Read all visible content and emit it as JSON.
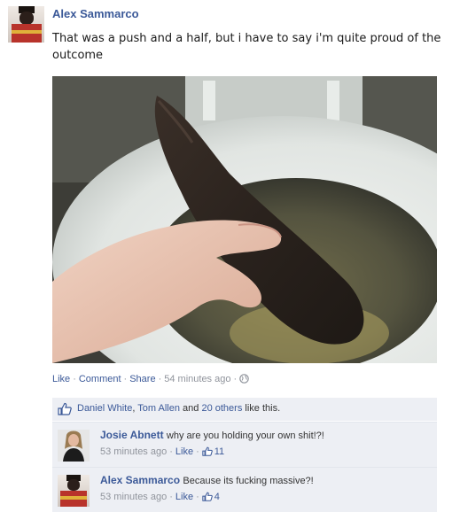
{
  "post": {
    "author": "Alex Sammarco",
    "status_text": "That was a push and a half, but i have to say i'm quite proud of the outcome"
  },
  "actions": {
    "like": "Like",
    "comment": "Comment",
    "share": "Share",
    "separator": "·",
    "timestamp": "54 minutes ago",
    "privacy_icon": "globe-icon"
  },
  "likes": {
    "name_1": "Daniel White",
    "comma": ",",
    "name_2": "Tom Allen",
    "and": "and",
    "others": "20 others",
    "suffix": "like this.",
    "icon": "thumbs-up-icon"
  },
  "comments": [
    {
      "author": "Josie Abnett",
      "text": "why are you holding your own shit!?!",
      "timestamp": "53 minutes ago",
      "like_label": "Like",
      "like_count": "11"
    },
    {
      "author": "Alex Sammarco",
      "text": "Because its fucking massive?!",
      "timestamp": "53 minutes ago",
      "like_label": "Like",
      "like_count": "4"
    }
  ],
  "colors": {
    "link": "#3b5998",
    "meta": "#90949c",
    "comment_bg": "#edeff4"
  }
}
